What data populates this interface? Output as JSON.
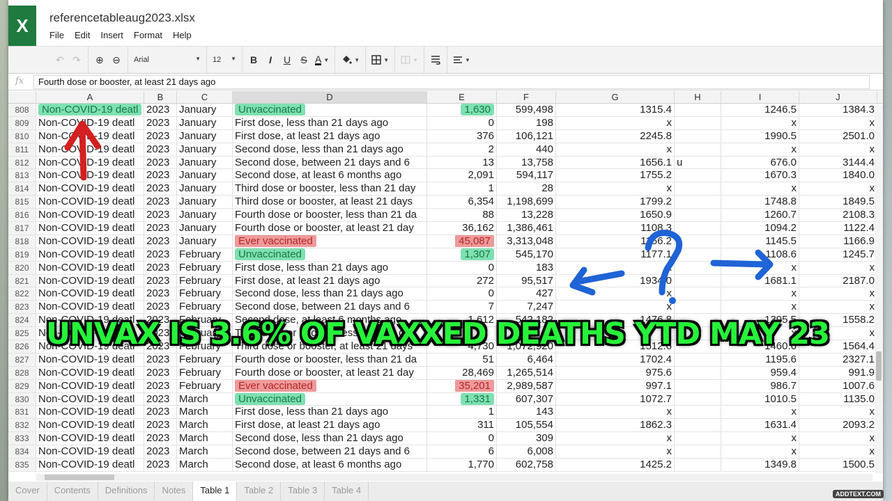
{
  "app": {
    "file_name": "referencetableaug2023.xlsx",
    "logo_letter": "X",
    "menu": [
      "File",
      "Edit",
      "Insert",
      "Format",
      "Help"
    ]
  },
  "toolbar": {
    "undo": "↶",
    "redo": "↷",
    "zoom_in": "⊕",
    "zoom_out": "⊖",
    "font": "Arial",
    "font_size": "12",
    "bold": "B",
    "italic": "I",
    "underline": "U",
    "strike": "S",
    "font_color": "A",
    "caret": "▼"
  },
  "formula_bar": {
    "fx_label": "fx",
    "value": "Fourth dose or booster, at least 21 days ago"
  },
  "columns": [
    "",
    "A",
    "B",
    "C",
    "D",
    "E",
    "F",
    "G",
    "H",
    "I",
    "J"
  ],
  "rows": [
    {
      "n": "808",
      "a": "Non-COVID-19 deatl",
      "b": "2023",
      "c": "January",
      "d": "Unvaccinated",
      "e": "1,630",
      "f": "599,498",
      "g": "1315.4",
      "h": "",
      "i": "1246.5",
      "j": "1384.3",
      "hl_d": "green",
      "hl_e": "green",
      "hl_a": "green"
    },
    {
      "n": "809",
      "a": "Non-COVID-19 deatl",
      "b": "2023",
      "c": "January",
      "d": "First dose, less than 21 days ago",
      "e": "0",
      "f": "198",
      "g": "x",
      "h": "",
      "i": "x",
      "j": "x"
    },
    {
      "n": "810",
      "a": "Non-COVID-19 deatl",
      "b": "2023",
      "c": "January",
      "d": "First dose, at least 21 days ago",
      "e": "376",
      "f": "106,121",
      "g": "2245.8",
      "h": "",
      "i": "1990.5",
      "j": "2501.0"
    },
    {
      "n": "811",
      "a": "Non-COVID-19 deatl",
      "b": "2023",
      "c": "January",
      "d": "Second dose, less than 21 days ago",
      "e": "2",
      "f": "440",
      "g": "x",
      "h": "",
      "i": "x",
      "j": "x"
    },
    {
      "n": "812",
      "a": "Non-COVID-19 deatl",
      "b": "2023",
      "c": "January",
      "d": "Second dose, between 21 days and 6",
      "e": "13",
      "f": "13,758",
      "g": "1656.1",
      "h": "u",
      "i": "676.0",
      "j": "3144.4"
    },
    {
      "n": "813",
      "a": "Non-COVID-19 deatl",
      "b": "2023",
      "c": "January",
      "d": "Second dose, at least 6 months ago",
      "e": "2,091",
      "f": "594,117",
      "g": "1755.2",
      "h": "",
      "i": "1670.3",
      "j": "1840.0"
    },
    {
      "n": "814",
      "a": "Non-COVID-19 deatl",
      "b": "2023",
      "c": "January",
      "d": "Third dose or booster, less than 21 day",
      "e": "1",
      "f": "28",
      "g": "x",
      "h": "",
      "i": "x",
      "j": "x"
    },
    {
      "n": "815",
      "a": "Non-COVID-19 deatl",
      "b": "2023",
      "c": "January",
      "d": "Third dose or booster, at least 21 days",
      "e": "6,354",
      "f": "1,198,699",
      "g": "1799.2",
      "h": "",
      "i": "1748.8",
      "j": "1849.5"
    },
    {
      "n": "816",
      "a": "Non-COVID-19 deatl",
      "b": "2023",
      "c": "January",
      "d": "Fourth dose or booster, less than 21 da",
      "e": "88",
      "f": "13,228",
      "g": "1650.9",
      "h": "",
      "i": "1260.7",
      "j": "2108.3"
    },
    {
      "n": "817",
      "a": "Non-COVID-19 deatl",
      "b": "2023",
      "c": "January",
      "d": "Fourth dose or booster, at least 21 day",
      "e": "36,162",
      "f": "1,386,461",
      "g": "1108.3",
      "h": "",
      "i": "1094.2",
      "j": "1122.4"
    },
    {
      "n": "818",
      "a": "Non-COVID-19 deatl",
      "b": "2023",
      "c": "January",
      "d": "Ever vaccinated",
      "e": "45,087",
      "f": "3,313,048",
      "g": "1156.2",
      "h": "",
      "i": "1145.5",
      "j": "1166.9",
      "hl_d": "red",
      "hl_e": "red"
    },
    {
      "n": "819",
      "a": "Non-COVID-19 deatl",
      "b": "2023",
      "c": "February",
      "d": "Unvaccinated",
      "e": "1,307",
      "f": "545,170",
      "g": "1177.1",
      "h": "",
      "i": "1108.6",
      "j": "1245.7",
      "hl_d": "green",
      "hl_e": "green"
    },
    {
      "n": "820",
      "a": "Non-COVID-19 deatl",
      "b": "2023",
      "c": "February",
      "d": "First dose, less than 21 days ago",
      "e": "0",
      "f": "183",
      "g": "x",
      "h": "",
      "i": "x",
      "j": "x"
    },
    {
      "n": "821",
      "a": "Non-COVID-19 deatl",
      "b": "2023",
      "c": "February",
      "d": "First dose, at least 21 days ago",
      "e": "272",
      "f": "95,517",
      "g": "1934.0",
      "h": "",
      "i": "1681.1",
      "j": "2187.0"
    },
    {
      "n": "822",
      "a": "Non-COVID-19 deatl",
      "b": "2023",
      "c": "February",
      "d": "Second dose, less than 21 days ago",
      "e": "0",
      "f": "427",
      "g": "x",
      "h": "",
      "i": "x",
      "j": "x"
    },
    {
      "n": "823",
      "a": "Non-COVID-19 deatl",
      "b": "2023",
      "c": "February",
      "d": "Second dose, between 21 days and 6",
      "e": "7",
      "f": "7,247",
      "g": "x",
      "h": "",
      "i": "x",
      "j": "x"
    },
    {
      "n": "824",
      "a": "Non-COVID-19 deatl",
      "b": "2023",
      "c": "February",
      "d": "Second dose, at least 6 months ago",
      "e": "1,612",
      "f": "542,182",
      "g": "1476.8",
      "h": "",
      "i": "1395.5",
      "j": "1558.2"
    },
    {
      "n": "825",
      "a": "Non-COVID-19 deatl",
      "b": "2023",
      "c": "February",
      "d": "Third dose or booster, less than 21 day",
      "e": "",
      "f": "",
      "g": "",
      "h": "",
      "i": "x",
      "j": "x"
    },
    {
      "n": "826",
      "a": "Non-COVID-19 deatl",
      "b": "2023",
      "c": "February",
      "d": "Third dose or booster, at least 21 days",
      "e": "4,730",
      "f": "1,072,920",
      "g": "1512.6",
      "h": "",
      "i": "1460.6",
      "j": "1564.4"
    },
    {
      "n": "827",
      "a": "Non-COVID-19 deatl",
      "b": "2023",
      "c": "February",
      "d": "Fourth dose or booster, less than 21 da",
      "e": "51",
      "f": "6,464",
      "g": "1702.4",
      "h": "",
      "i": "1195.6",
      "j": "2327.1"
    },
    {
      "n": "828",
      "a": "Non-COVID-19 deatl",
      "b": "2023",
      "c": "February",
      "d": "Fourth dose or booster, at least 21 day",
      "e": "28,469",
      "f": "1,265,514",
      "g": "975.6",
      "h": "",
      "i": "959.4",
      "j": "991.9"
    },
    {
      "n": "829",
      "a": "Non-COVID-19 deatl",
      "b": "2023",
      "c": "February",
      "d": "Ever vaccinated",
      "e": "35,201",
      "f": "2,989,587",
      "g": "997.1",
      "h": "",
      "i": "986.7",
      "j": "1007.6",
      "hl_d": "red",
      "hl_e": "red"
    },
    {
      "n": "830",
      "a": "Non-COVID-19 deatl",
      "b": "2023",
      "c": "March",
      "d": "Unvaccinated",
      "e": "1,331",
      "f": "607,307",
      "g": "1072.7",
      "h": "",
      "i": "1010.5",
      "j": "1135.0",
      "hl_d": "green",
      "hl_e": "green"
    },
    {
      "n": "831",
      "a": "Non-COVID-19 deatl",
      "b": "2023",
      "c": "March",
      "d": "First dose, less than 21 days ago",
      "e": "1",
      "f": "143",
      "g": "x",
      "h": "",
      "i": "x",
      "j": "x"
    },
    {
      "n": "832",
      "a": "Non-COVID-19 deatl",
      "b": "2023",
      "c": "March",
      "d": "First dose, at least 21 days ago",
      "e": "311",
      "f": "105,554",
      "g": "1862.3",
      "h": "",
      "i": "1631.4",
      "j": "2093.2"
    },
    {
      "n": "833",
      "a": "Non-COVID-19 deatl",
      "b": "2023",
      "c": "March",
      "d": "Second dose, less than 21 days ago",
      "e": "0",
      "f": "309",
      "g": "x",
      "h": "",
      "i": "x",
      "j": "x"
    },
    {
      "n": "834",
      "a": "Non-COVID-19 deatl",
      "b": "2023",
      "c": "March",
      "d": "Second dose, between 21 days and 6",
      "e": "6",
      "f": "6,008",
      "g": "x",
      "h": "",
      "i": "x",
      "j": "x"
    },
    {
      "n": "835",
      "a": "Non-COVID-19 deatl",
      "b": "2023",
      "c": "March",
      "d": "Second dose, at least 6 months ago",
      "e": "1,770",
      "f": "602,758",
      "g": "1425.2",
      "h": "",
      "i": "1349.8",
      "j": "1500.5"
    }
  ],
  "sheet_tabs": [
    {
      "label": "Cover",
      "active": false
    },
    {
      "label": "Contents",
      "active": false
    },
    {
      "label": "Definitions",
      "active": false
    },
    {
      "label": "Notes",
      "active": false
    },
    {
      "label": "Table 1",
      "active": true
    },
    {
      "label": "Table 2",
      "active": false
    },
    {
      "label": "Table 3",
      "active": false
    },
    {
      "label": "Table 4",
      "active": false
    }
  ],
  "overlay": {
    "caption": "UNVAX IS 3.6% OF VAXXED DEATHS YTD MAY 23",
    "question_mark": "?",
    "watermark": "ADDTEXT.COM"
  },
  "colors": {
    "excel_green": "#1e7a3e",
    "highlight_green": "#7fe0b2",
    "highlight_red": "#ee9a9a",
    "caption_green": "#27f23a",
    "annotation_red": "#d42020",
    "annotation_blue": "#1f63d6"
  }
}
